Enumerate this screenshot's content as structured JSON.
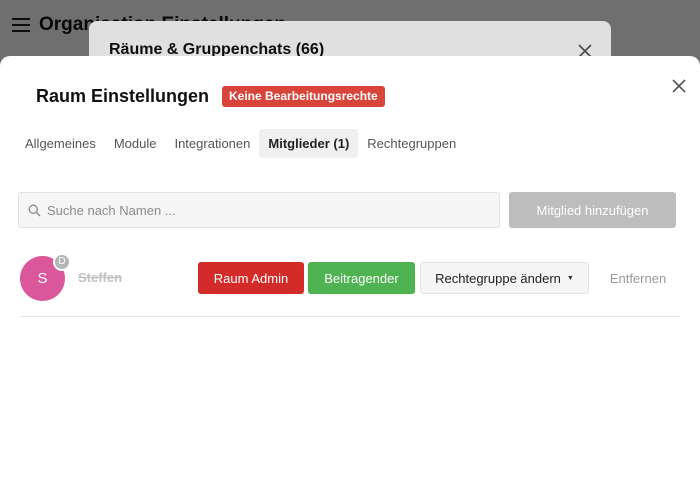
{
  "background": {
    "title": "Organisation Einstellungen"
  },
  "middle_dialog": {
    "title": "Räume & Gruppenchats (66)"
  },
  "dialog": {
    "title": "Raum Einstellungen",
    "badge": "Keine Bearbeitungsrechte",
    "tabs": [
      {
        "label": "Allgemeines",
        "active": false
      },
      {
        "label": "Module",
        "active": false
      },
      {
        "label": "Integrationen",
        "active": false
      },
      {
        "label": "Mitglieder (1)",
        "active": true
      },
      {
        "label": "Rechtegruppen",
        "active": false
      }
    ],
    "search": {
      "placeholder": "Suche nach Namen ...",
      "value": ""
    },
    "add_member_label": "Mitglied hinzufügen",
    "members": [
      {
        "initial": "S",
        "badge": "D",
        "name": "Steffen",
        "avatar_color": "#d9579a",
        "admin_label": "Raum Admin",
        "contributor_label": "Beitragender",
        "group_label": "Rechtegruppe ändern",
        "remove_label": "Entfernen"
      }
    ]
  },
  "colors": {
    "badge": "#d9443a",
    "admin": "#d32a2a",
    "contributor": "#4fb352",
    "add_disabled": "#bdbdbd"
  }
}
